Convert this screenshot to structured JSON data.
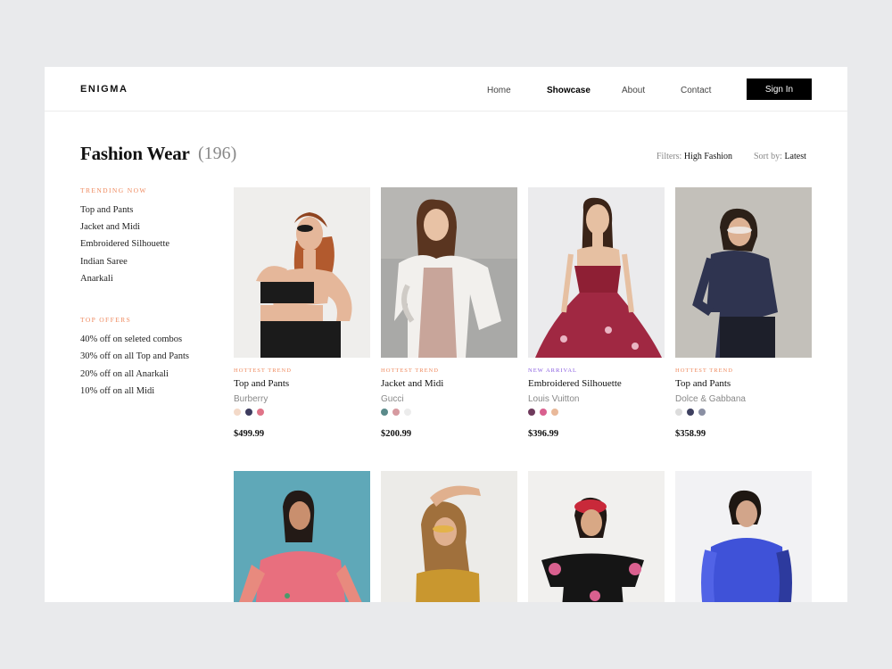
{
  "header": {
    "logo": "ENIGMA",
    "nav": [
      "Home",
      "Showcase",
      "About",
      "Contact"
    ],
    "active_nav": "Showcase",
    "signin_label": "Sign In"
  },
  "page": {
    "title": "Fashion Wear",
    "count": "(196)",
    "filters_label": "Filters:",
    "filters_value": "High Fashion",
    "sort_label": "Sort by:",
    "sort_value": "Latest"
  },
  "sidebar": {
    "trending_heading": "TRENDING NOW",
    "trending": [
      "Top and Pants",
      "Jacket and Midi",
      "Embroidered Silhouette",
      "Indian Saree",
      "Anarkali"
    ],
    "offers_heading": "TOP OFFERS",
    "offers": [
      "40% off on seleted combos",
      "30% off on all Top and Pants",
      "20% off on all Anarkali",
      "10% off on all Midi"
    ]
  },
  "products": [
    {
      "tag": "HOTTEST TREND",
      "name": "Top and Pants",
      "brand": "Burberry",
      "price": "$499.99",
      "swatches": [
        "#f3d9c8",
        "#3d3b5e",
        "#e07488"
      ]
    },
    {
      "tag": "HOTTEST TREND",
      "name": "Jacket and Midi",
      "brand": "Gucci",
      "price": "$200.99",
      "swatches": [
        "#5a8a8a",
        "#d69aa0",
        "#ececec"
      ]
    },
    {
      "tag": "NEW ARRIVAL",
      "name": "Embroidered Silhouette",
      "brand": "Louis Vuitton",
      "price": "$396.99",
      "swatches": [
        "#6f3a5c",
        "#d9608f",
        "#e9b99a"
      ]
    },
    {
      "tag": "HOTTEST TREND",
      "name": "Top and Pants",
      "brand": "Dolce & Gabbana",
      "price": "$358.99",
      "swatches": [
        "#dcdcdc",
        "#3e4060",
        "#8a8fa3"
      ]
    },
    {
      "image": "woman in pink saree against teal wall"
    },
    {
      "image": "woman in gold sequin top with sunglasses"
    },
    {
      "image": "woman in black off-shoulder floral dress"
    },
    {
      "image": "woman in blue fur coat"
    }
  ],
  "colors": {
    "accent": "#ef8a5f",
    "new_arrival": "#8a5fe0",
    "background": "#e9eaec"
  }
}
